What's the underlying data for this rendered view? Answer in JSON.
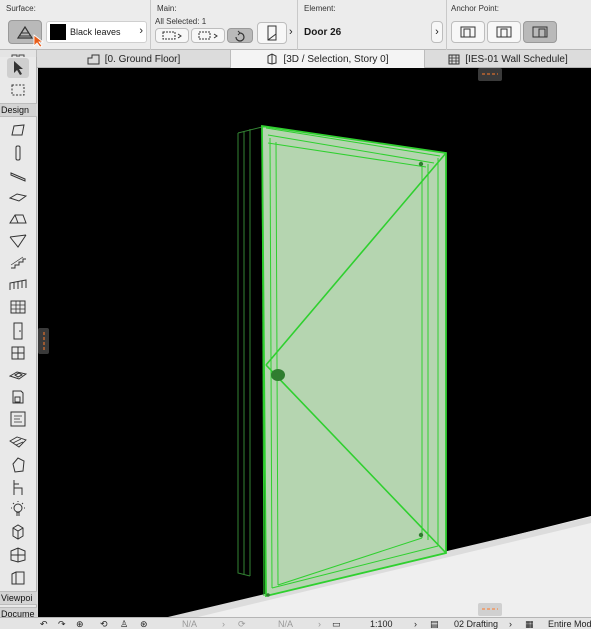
{
  "infobox": {
    "surface": {
      "label": "Surface:",
      "material": "Black leaves",
      "material_color": "#000000"
    },
    "main": {
      "label": "Main:",
      "selection_text": "All Selected: 1"
    },
    "element": {
      "label": "Element:",
      "name": "Door 26"
    },
    "anchor": {
      "label": "Anchor Point:"
    }
  },
  "tabs": [
    {
      "label": "[0. Ground Floor]",
      "icon": "floor-plan-icon",
      "active": false
    },
    {
      "label": "[3D / Selection, Story 0]",
      "icon": "3d-cube-icon",
      "active": true
    },
    {
      "label": "[IES-01 Wall Schedule]",
      "icon": "schedule-table-icon",
      "active": false
    }
  ],
  "toolbox": {
    "design_header": "Design",
    "viewpoints_header": "Viewpoi",
    "documents_header": "Docume",
    "tools": [
      "arrow-select",
      "marquee",
      "wall",
      "column",
      "beam",
      "slab",
      "roof",
      "shell",
      "mesh",
      "stair",
      "railing",
      "curtain-wall",
      "door",
      "window",
      "skylight",
      "zone",
      "object",
      "morph",
      "lamp",
      "opening",
      "wall-end",
      "corner-window",
      "object-2",
      "section"
    ]
  },
  "statusbar": {
    "na1": "N/A",
    "na2": "N/A",
    "scale": "1:100",
    "layer_combo": "02 Drafting",
    "model_view": "Entire Mod"
  },
  "colors": {
    "selection_green": "#2fd02f",
    "door_fill": "#b5d5b0",
    "viewport_bg": "#000000",
    "floor": "#f0f0f0"
  }
}
